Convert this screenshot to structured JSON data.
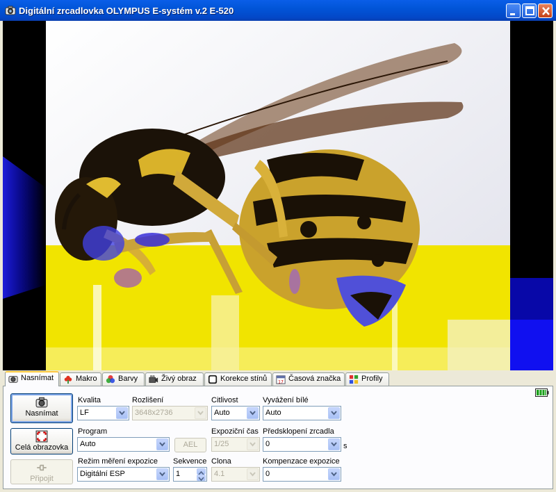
{
  "window": {
    "title": "Digitální zrcadlovka OLYMPUS E-systém v.2  E-520",
    "minimize_icon": "minimize-icon",
    "maximize_icon": "maximize-icon",
    "close_icon": "close-icon"
  },
  "tabs": [
    {
      "label": "Nasnímat",
      "icon": "camera-icon",
      "active": true
    },
    {
      "label": "Makro",
      "icon": "flower-icon"
    },
    {
      "label": "Barvy",
      "icon": "rgb-circles-icon"
    },
    {
      "label": "Živý obraz",
      "icon": "video-camera-icon"
    },
    {
      "label": "Korekce stínů",
      "icon": "shadow-correction-icon"
    },
    {
      "label": "Časová značka",
      "icon": "calendar-icon"
    },
    {
      "label": "Profily",
      "icon": "profiles-grid-icon"
    }
  ],
  "buttons": {
    "capture": "Nasnímat",
    "fullscreen": "Celá obrazovka",
    "connect": "Připojit",
    "ael": "AEL"
  },
  "fields": {
    "quality": {
      "label": "Kvalita",
      "value": "LF"
    },
    "resolution": {
      "label": "Rozlišení",
      "value": "3648x2736"
    },
    "sensitivity": {
      "label": "Citlivost",
      "value": "Auto"
    },
    "white_balance": {
      "label": "Vyvážení bílé",
      "value": "Auto"
    },
    "program": {
      "label": "Program",
      "value": "Auto"
    },
    "exposure_time": {
      "label": "Expoziční čas",
      "value": "1/25"
    },
    "mirror_prelift": {
      "label": "Předsklopení zrcadla",
      "value": "0",
      "unit": "s"
    },
    "metering": {
      "label": "Režim měření expozice",
      "value": "Digitální ESP"
    },
    "sequence": {
      "label": "Sekvence",
      "value": "1"
    },
    "aperture": {
      "label": "Clona",
      "value": "4.1"
    },
    "exposure_comp": {
      "label": "Kompenzace expozice",
      "value": "0"
    }
  },
  "status": {
    "battery_icon": "battery-full-icon"
  },
  "colors": {
    "title_bar": "#0155d8",
    "tab_highlight": "#ffc83c",
    "glitch_yellow": "#f4ea00",
    "glitch_blue": "#1a1aff"
  }
}
